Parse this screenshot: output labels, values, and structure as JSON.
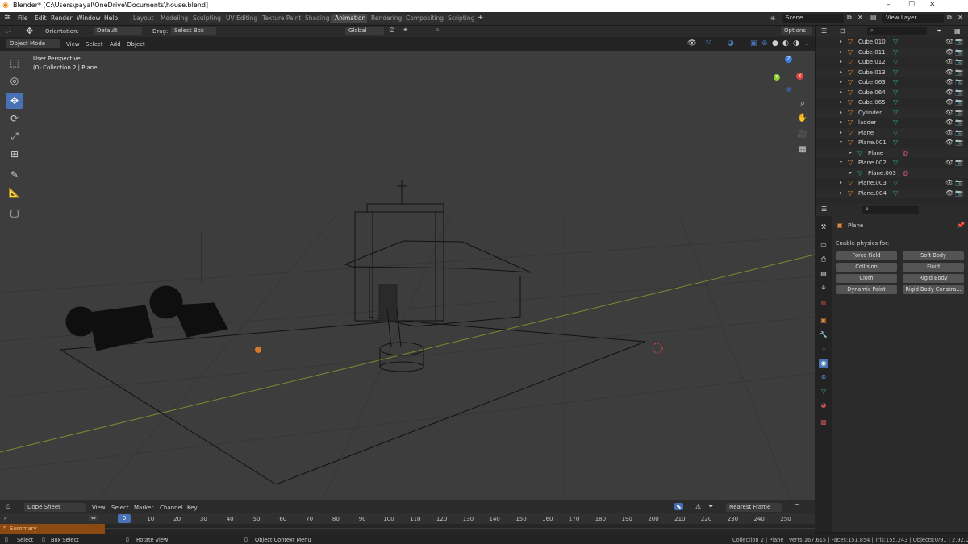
{
  "window": {
    "title": "Blender* [C:\\Users\\payal\\OneDrive\\Documents\\house.blend]",
    "minimize": "–",
    "maximize": "☐",
    "close": "✕"
  },
  "menu": {
    "items": [
      "File",
      "Edit",
      "Render",
      "Window",
      "Help"
    ]
  },
  "workspaces": {
    "tabs": [
      "Layout",
      "Modeling",
      "Sculpting",
      "UV Editing",
      "Texture Paint",
      "Shading",
      "Animation",
      "Rendering",
      "Compositing",
      "Scripting"
    ],
    "active": "Animation",
    "add": "+"
  },
  "scene": {
    "label": "Scene",
    "view_layer": "View Layer"
  },
  "tool_settings": {
    "orientation_label": "Orientation:",
    "orientation_value": "Default",
    "drag_label": "Drag:",
    "drag_value": "Select Box",
    "transform_orientation": "Global",
    "options": "Options"
  },
  "viewport_header": {
    "mode": "Object Mode",
    "menus": [
      "View",
      "Select",
      "Add",
      "Object"
    ]
  },
  "viewport": {
    "perspective": "User Perspective",
    "collection_info": "(0) Collection 2 | Plane",
    "gizmo": {
      "x": "X",
      "y": "Y",
      "z": "Z"
    }
  },
  "outliner": {
    "search_placeholder": "",
    "rows": [
      {
        "name": "Cube.010",
        "expanded": false,
        "child": false
      },
      {
        "name": "Cube.011",
        "expanded": false,
        "child": false
      },
      {
        "name": "Cube.012",
        "expanded": false,
        "child": false
      },
      {
        "name": "Cube.013",
        "expanded": false,
        "child": false
      },
      {
        "name": "Cube.063",
        "expanded": false,
        "child": false
      },
      {
        "name": "Cube.064",
        "expanded": false,
        "child": false
      },
      {
        "name": "Cube.065",
        "expanded": false,
        "child": false
      },
      {
        "name": "Cylinder",
        "expanded": false,
        "child": false
      },
      {
        "name": "ladder",
        "expanded": false,
        "child": false
      },
      {
        "name": "Plane",
        "expanded": false,
        "child": false
      },
      {
        "name": "Plane.001",
        "expanded": true,
        "child": false
      },
      {
        "name": "Plane",
        "expanded": false,
        "child": true
      },
      {
        "name": "Plane.002",
        "expanded": true,
        "child": false
      },
      {
        "name": "Plane.003",
        "expanded": false,
        "child": true
      },
      {
        "name": "Plane.003",
        "expanded": false,
        "child": false
      },
      {
        "name": "Plane.004",
        "expanded": false,
        "child": false
      }
    ]
  },
  "properties": {
    "object_name": "Plane",
    "section_label": "Enable physics for:",
    "buttons": [
      [
        "Force Field",
        "Soft Body"
      ],
      [
        "Collision",
        "Fluid"
      ],
      [
        "Cloth",
        "Rigid Body"
      ],
      [
        "Dynamic Paint",
        "Rigid Body Constra..."
      ]
    ]
  },
  "dopesheet": {
    "editor": "Dope Sheet",
    "menus": [
      "View",
      "Select",
      "Marker",
      "Channel",
      "Key"
    ],
    "snap": "Nearest Frame",
    "current_frame": "0",
    "ticks": [
      "10",
      "20",
      "30",
      "40",
      "50",
      "60",
      "70",
      "80",
      "90",
      "100",
      "110",
      "120",
      "130",
      "140",
      "150",
      "160",
      "170",
      "180",
      "190",
      "200",
      "210",
      "220",
      "230",
      "240",
      "250"
    ],
    "summary": "Summary"
  },
  "statusbar": {
    "left": [
      "Select",
      "Box Select",
      "Rotate View",
      "Object Context Menu"
    ],
    "right": "Collection 2 | Plane | Verts:167,615 | Faces:151,854 | Tris:155,243 | Objects:0/91 | 2.92.0"
  },
  "colors": {
    "accent": "#4772b3",
    "orange": "#e08a3a",
    "object_tri": "#2bb37a"
  }
}
